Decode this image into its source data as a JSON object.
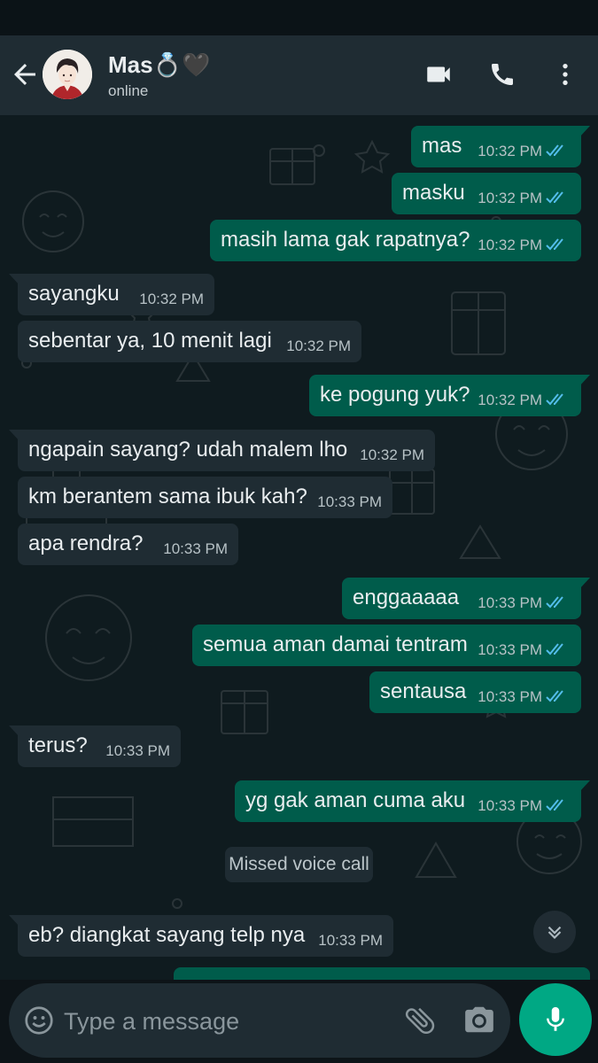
{
  "header": {
    "contact_name": "Mas💍🖤",
    "status": "online"
  },
  "messages": [
    {
      "dir": "out",
      "text": "mas",
      "time": "10:32 PM"
    },
    {
      "dir": "out",
      "text": "masku",
      "time": "10:32 PM"
    },
    {
      "dir": "out",
      "text": "masih lama gak rapatnya?",
      "time": "10:32 PM"
    },
    {
      "dir": "in",
      "text": "sayangku",
      "time": "10:32 PM"
    },
    {
      "dir": "in",
      "text": "sebentar ya, 10 menit lagi",
      "time": "10:32 PM"
    },
    {
      "dir": "out",
      "text": "ke pogung yuk?",
      "time": "10:32 PM"
    },
    {
      "dir": "in",
      "text": "ngapain sayang? udah malem lho",
      "time": "10:32 PM"
    },
    {
      "dir": "in",
      "text": "km berantem sama ibuk kah?",
      "time": "10:33 PM"
    },
    {
      "dir": "in",
      "text": "apa rendra?",
      "time": "10:33 PM"
    },
    {
      "dir": "out",
      "text": "enggaaaaa",
      "time": "10:33 PM"
    },
    {
      "dir": "out",
      "text": "semua aman damai tentram",
      "time": "10:33 PM"
    },
    {
      "dir": "out",
      "text": "sentausa",
      "time": "10:33 PM"
    },
    {
      "dir": "in",
      "text": "terus?",
      "time": "10:33 PM"
    },
    {
      "dir": "out",
      "text": "yg gak aman cuma aku",
      "time": "10:33 PM"
    },
    {
      "dir": "in",
      "text": "eb? diangkat sayang telp nya",
      "time": "10:33 PM"
    }
  ],
  "system_message": "Missed voice call",
  "composer": {
    "placeholder": "Type a message"
  },
  "colors": {
    "header_bg": "#1f2c33",
    "outgoing_bubble": "#005c4b",
    "incoming_bubble": "#1f2c33",
    "read_ticks": "#53bdeb",
    "mic_button": "#00a884"
  },
  "icons": [
    "back-arrow-icon",
    "video-call-icon",
    "phone-icon",
    "more-vert-icon",
    "double-check-icon",
    "chevron-down-icon",
    "emoji-icon",
    "paperclip-icon",
    "camera-icon",
    "mic-icon"
  ]
}
